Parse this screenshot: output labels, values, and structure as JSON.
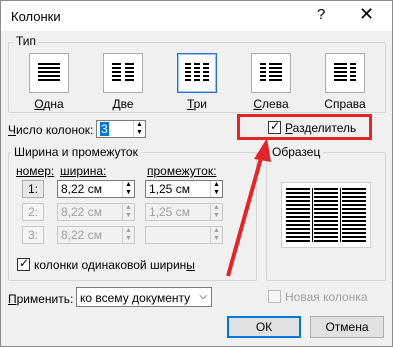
{
  "window": {
    "title": "Колонки",
    "help": "?",
    "close": "✕"
  },
  "type_group": {
    "legend": "Тип",
    "presets": [
      {
        "label": "Одна",
        "accel": "О",
        "rest": "дна",
        "icon": "one-column-icon"
      },
      {
        "label": "Две",
        "accel": "Д",
        "rest": "ве",
        "icon": "two-columns-icon"
      },
      {
        "label": "Три",
        "accel": "Т",
        "rest": "ри",
        "icon": "three-columns-icon"
      },
      {
        "label": "Слева",
        "accel": "С",
        "rest": "лева",
        "icon": "left-column-icon"
      },
      {
        "label": "Справа",
        "accel": "",
        "rest": "Справа",
        "icon": "right-column-icon"
      }
    ],
    "selected": "Три"
  },
  "columns_count": {
    "label_accel": "Ч",
    "label_rest": "исло колонок:",
    "value": "3"
  },
  "separator": {
    "label_accel": "Р",
    "label_rest": "азделитель",
    "checked": true
  },
  "width_group": {
    "legend": "Ширина и промежуток",
    "col_number_header": "номер:",
    "width_header": "ширина:",
    "spacing_header": "промежуток:",
    "rows": [
      {
        "num": "1:",
        "width": "8,22 см",
        "spacing": "1,25 см"
      },
      {
        "num": "2:",
        "width": "8,22 см",
        "spacing": "1,25 см"
      },
      {
        "num": "3:",
        "width": "8,22 см",
        "spacing": ""
      }
    ],
    "equal_width": {
      "label_main": "колонки одинаковой ширин",
      "label_accel": "ы",
      "checked": true
    }
  },
  "preview": {
    "legend": "Образец"
  },
  "apply": {
    "label_accel": "П",
    "label_rest": "рименить:",
    "value": "ко всему документу"
  },
  "new_column": {
    "label": "Новая колонка",
    "checked": false
  },
  "buttons": {
    "ok": "ОК",
    "cancel": "Отмена"
  },
  "colors": {
    "annotation": "#e0262b",
    "selection": "#2f6fd0"
  }
}
